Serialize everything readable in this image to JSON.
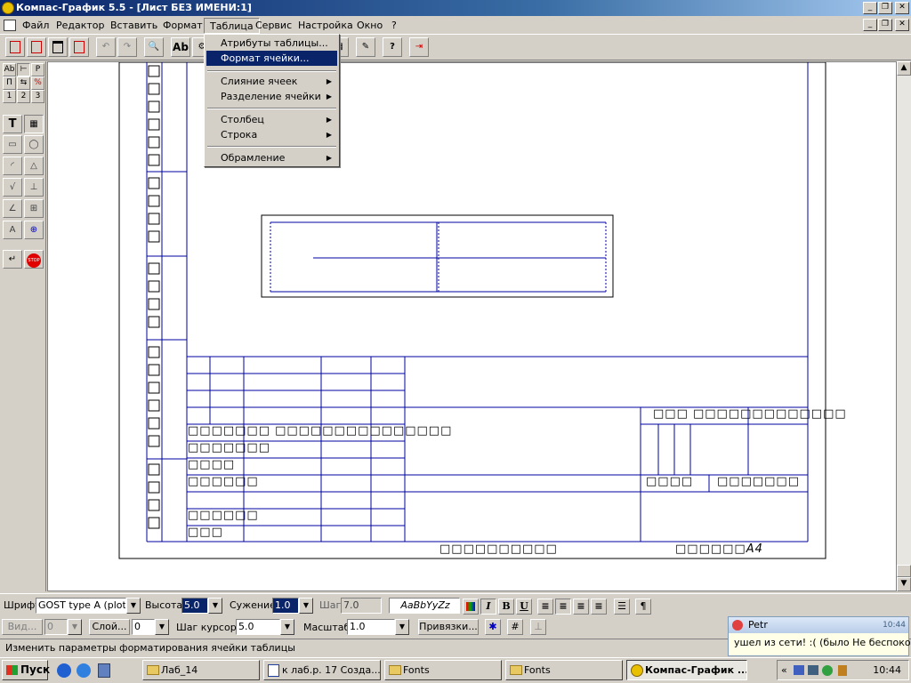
{
  "window": {
    "title": "Компас-График 5.5 - [Лист БЕЗ ИМЕНИ:1]",
    "controls": [
      "_",
      "❐",
      "✕"
    ]
  },
  "menu": {
    "items": [
      "Файл",
      "Редактор",
      "Вставить",
      "Формат",
      "Таблица",
      "Сервис",
      "Настройка",
      "Окно",
      "?"
    ],
    "open_index": 4
  },
  "dropdown": {
    "items": [
      {
        "label": "Атрибуты таблицы..."
      },
      {
        "label": "Формат ячейки..."
      },
      {
        "label": "Слияние ячеек"
      },
      {
        "label": "Разделение ячейки"
      },
      {
        "label": "Столбец"
      },
      {
        "label": "Строка"
      },
      {
        "label": "Обрамление"
      }
    ],
    "highlighted": "Формат ячейки..."
  },
  "leftpanel": {
    "row2": [
      "П",
      "⇆",
      "%"
    ],
    "row3": [
      "1",
      "2",
      "3"
    ]
  },
  "drawing": {
    "title_block_text": {
      "r1": "□□□□□□□ □□□□□□□□□□□□□□□",
      "r2": "□□□□□□□",
      "r3": "□□□□",
      "r4": "□□□□□□",
      "r5": "□□□□□□",
      "r6": "□□□",
      "right_top": "□□□ □□□□□□□□□□□□□",
      "right_mid1": "□□□□",
      "right_mid2": "□□□□□□□",
      "bottom1": "□□□□□□□□□□",
      "bottom2": "□□□□□□А4"
    }
  },
  "font_bar": {
    "font_label": "Шрифт",
    "font_value": "GOST type A (plotter",
    "height_label": "Высота",
    "height_value": "5.0",
    "narrow_label": "Сужение",
    "narrow_value": "1.0",
    "step_label": "Шаг",
    "step_value": "7.0",
    "preview": "AaBbYyZz",
    "italic": "I",
    "bold": "B",
    "underline": "U",
    "para": "¶"
  },
  "view_bar": {
    "view_label": "Вид...",
    "view_value": "0",
    "layer_label": "Слой...",
    "layer_value": "0",
    "cursor_label": "Шаг курсора",
    "cursor_value": "5.0",
    "scale_label": "Масштаб",
    "scale_value": "1.0",
    "snap_label": "Привязки..."
  },
  "hint": "Изменить параметры форматирования ячейки таблицы",
  "taskbar": {
    "start": "Пуск",
    "tasks": [
      "Лаб_14",
      "к лаб.р. 17 Созда...",
      "Fonts",
      "Fonts",
      "Компас-График ..."
    ],
    "clock": "10:44"
  },
  "popup": {
    "name": "Petr",
    "time": "10:44",
    "message": "ушел из сети! :( (было Не беспокоит"
  },
  "colors": {
    "drawing_line": "#0000a0",
    "title_gradient_start": "#0a246a",
    "menu_highlight": "#0a246a"
  }
}
